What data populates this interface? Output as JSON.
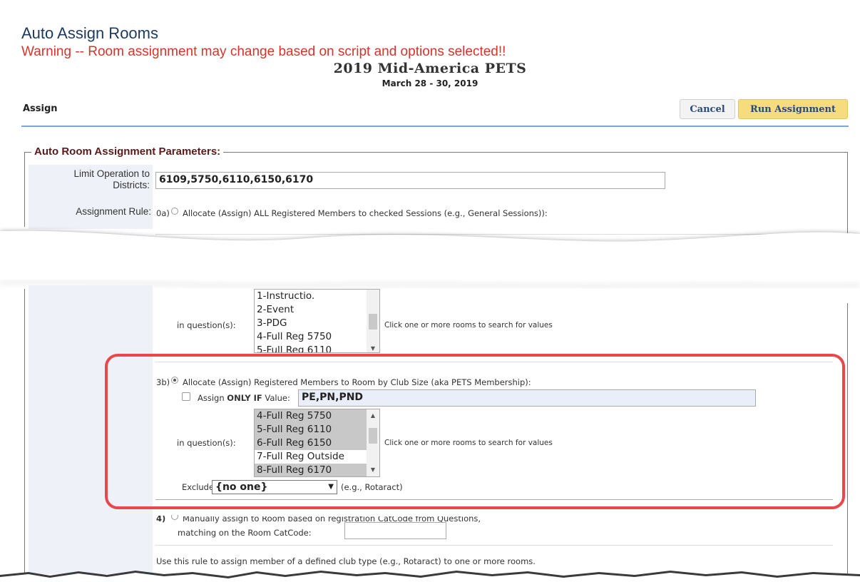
{
  "header": {
    "title": "Auto Assign Rooms",
    "warning": "Warning -- Room assignment may change based on script and options selected!!",
    "event_name": "2019 Mid-America PETS",
    "event_dates": "March 28 - 30, 2019"
  },
  "toolbar": {
    "section_label": "Assign",
    "cancel_label": "Cancel",
    "run_label": "Run Assignment"
  },
  "params": {
    "legend": "Auto Room Assignment Parameters:",
    "limit_label_line1": "Limit Operation to",
    "limit_label_line2": "Districts:",
    "districts_value": "6109,5750,6110,6150,6170",
    "assignment_rule_label": "Assignment Rule:",
    "rule_0a_prefix": "0a)",
    "rule_0a_text": "Allocate (Assign) ALL Registered Members to checked Sessions (e.g., General Sessions)):"
  },
  "question_block_1": {
    "label": "in question(s):",
    "items": [
      "1-Instructio.",
      "2-Event",
      "3-PDG",
      "4-Full Reg 5750",
      "5-Full Reg 6110"
    ],
    "hint": "Click one or more rooms to search for values"
  },
  "rule_3b": {
    "prefix": "3b)",
    "text": "Allocate (Assign) Registered Members to Room by Club Size (aka PETS Membership):",
    "assign_only_if_pre": "Assign ",
    "assign_only_if_bold": "ONLY IF",
    "assign_only_if_post": " Value:",
    "value": "PE,PN,PND",
    "questions_label": "in question(s):",
    "items": [
      {
        "label": "4-Full Reg 5750",
        "selected": true
      },
      {
        "label": "5-Full Reg 6110",
        "selected": true
      },
      {
        "label": "6-Full Reg 6150",
        "selected": true
      },
      {
        "label": "7-Full Reg Outside",
        "selected": false
      },
      {
        "label": "8-Full Reg 6170",
        "selected": true
      }
    ],
    "hint": "Click one or more rooms to search for values",
    "exclude_label": "Exclude",
    "exclude_value": "{no one}",
    "exclude_hint": "(e.g., Rotaract)"
  },
  "rule_4": {
    "prefix": "4)",
    "text": "Manually assign to Room based on registration CatCode from Questions,",
    "line2": "matching on the Room CatCode:"
  },
  "footer_note": "Use this rule to assign member of a defined club type (e.g., Rotaract) to one or more rooms.",
  "colors": {
    "warning": "#d4352c",
    "highlight": "#e8474b",
    "run_button": "#f6dc7c",
    "accent_line": "#7ea6cf"
  }
}
